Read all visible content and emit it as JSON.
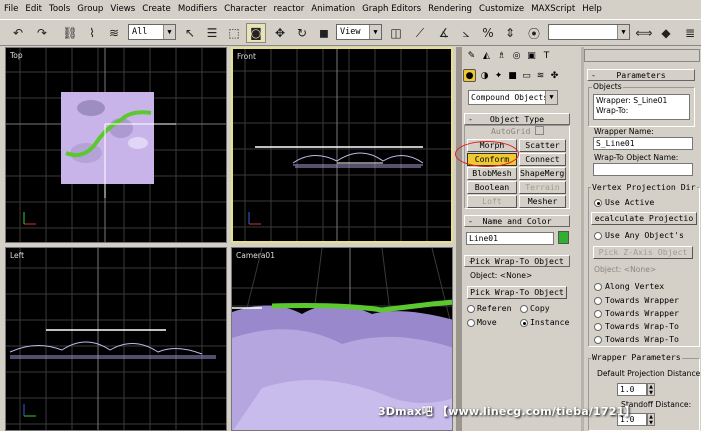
{
  "menu": [
    "File",
    "Edit",
    "Tools",
    "Group",
    "Views",
    "Create",
    "Modifiers",
    "Character",
    "reactor",
    "Animation",
    "Graph Editors",
    "Rendering",
    "Customize",
    "MAXScript",
    "Help"
  ],
  "toolbar": {
    "selection_filter": "All",
    "view_combo": "View"
  },
  "viewports": {
    "top": "Top",
    "front": "Front",
    "left": "Left",
    "camera": "Camera01"
  },
  "panel": {
    "category": "Compound Objects",
    "object_type": {
      "header": "Object Type",
      "autogrid": "AutoGrid",
      "buttons": [
        "Morph",
        "Scatter",
        "Conform",
        "Connect",
        "BlobMesh",
        "ShapeMerge",
        "Boolean",
        "Terrain",
        "Loft",
        "Mesher"
      ]
    },
    "name_color": {
      "header": "Name and Color",
      "name": "Line01",
      "color": "#30b030"
    },
    "pick": {
      "header": "Pick Wrap-To Object",
      "object_label": "Object: <None>",
      "button": "Pick Wrap-To Object",
      "reference": "Referen",
      "copy": "Copy",
      "move": "Move",
      "instance": "Instance"
    }
  },
  "params": {
    "header": "Parameters",
    "objects": {
      "label": "Objects",
      "wrapper": "Wrapper: S_Line01",
      "wrapto": "Wrap-To:"
    },
    "wrapper_name_label": "Wrapper Name:",
    "wrapper_name": "S_Line01",
    "wrapto_name_label": "Wrap-To Object Name:",
    "wrapto_name": "",
    "vp_dir": {
      "label": "Vertex Projection Dir",
      "use_active": "Use Active",
      "recalc": "ecalculate Projectio",
      "use_any": "Use Any Object's",
      "pick_z": "Pick Z-Axis Object",
      "object": "Object: <None>",
      "along": "Along Vertex",
      "towards_wrapper": "Towards Wrapper",
      "towards_wrapper2": "Towards Wrapper",
      "towards_wrapto": "Towards Wrap-To",
      "towards_wrapto2": "Towards Wrap-To"
    },
    "wrapper_params": {
      "label": "Wrapper Parameters",
      "default_dist_label": "Default Projection Distance:",
      "default_dist": "1.0",
      "standoff_label": "Standoff Distance:",
      "standoff": "1.0"
    }
  },
  "watermark": "3Dmax吧 【www.linecg.com/tieba/1721】"
}
